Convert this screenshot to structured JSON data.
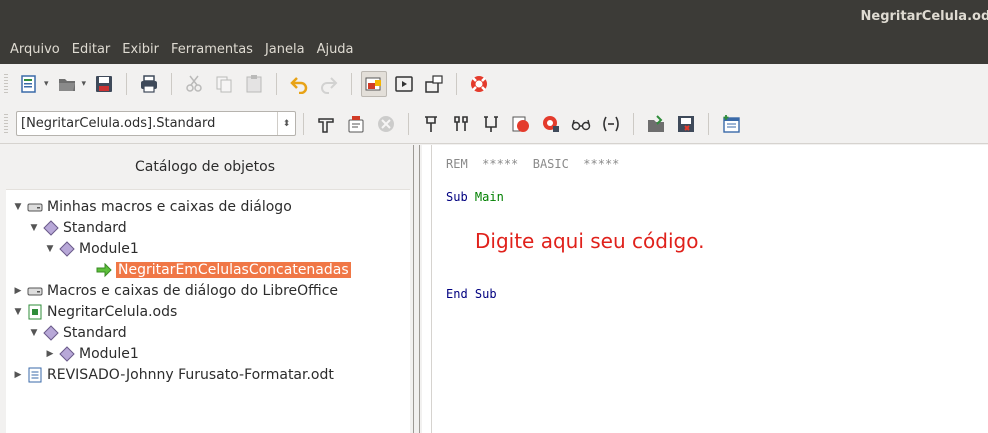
{
  "window": {
    "title": "NegritarCelula.ods"
  },
  "menubar": {
    "items": [
      "Arquivo",
      "Editar",
      "Exibir",
      "Ferramentas",
      "Janela",
      "Ajuda"
    ]
  },
  "toolbar2": {
    "library_combo": "[NegritarCelula.ods].Standard"
  },
  "catalog": {
    "heading": "Catálogo de objetos",
    "tree": {
      "my_macros": "Minhas macros e caixas de diálogo",
      "standard1": "Standard",
      "module1_a": "Module1",
      "macro_selected": "NegritarEmCelulasConcatenadas",
      "lo_macros": "Macros e caixas de diálogo do LibreOffice",
      "doc_ods": "NegritarCelula.ods",
      "standard2": "Standard",
      "module1_b": "Module1",
      "doc_odt": "REVISADO-Johnny Furusato-Formatar.odt"
    }
  },
  "editor": {
    "rem_kw": "REM",
    "rem_comment": "*****  BASIC  *****",
    "sub_kw": "Sub",
    "sub_name": "Main",
    "hint": "Digite aqui seu código.",
    "end_sub": "End Sub"
  },
  "colors": {
    "selection": "#f07746",
    "titlebar": "#3c3b37",
    "hint": "#e0211b"
  }
}
